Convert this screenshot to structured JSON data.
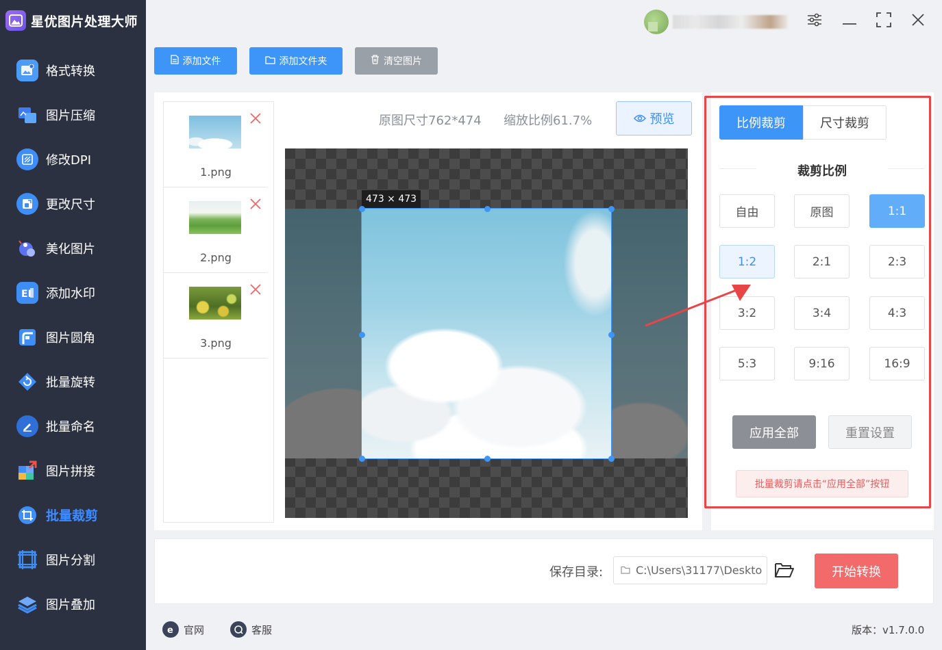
{
  "app": {
    "title": "星优图片处理大师",
    "logo_icon": "mountain-photo-icon"
  },
  "sidebar": {
    "items": [
      {
        "label": "格式转换",
        "icon": "image-convert-icon",
        "color": "#4b9bf7"
      },
      {
        "label": "图片压缩",
        "icon": "image-compress-icon",
        "color": "#3e7cf0"
      },
      {
        "label": "修改DPI",
        "icon": "dpi-icon",
        "color": "#3e8ef5"
      },
      {
        "label": "更改尺寸",
        "icon": "resize-icon",
        "color": "#3e8ef5"
      },
      {
        "label": "美化图片",
        "icon": "beautify-icon",
        "color": "#5a72f0"
      },
      {
        "label": "添加水印",
        "icon": "watermark-icon",
        "color": "#3e8ef5"
      },
      {
        "label": "图片圆角",
        "icon": "rounded-corner-icon",
        "color": "#3e8ef5"
      },
      {
        "label": "批量旋转",
        "icon": "rotate-icon",
        "color": "#3e8ef5"
      },
      {
        "label": "批量命名",
        "icon": "rename-icon",
        "color": "#3e8ef5"
      },
      {
        "label": "图片拼接",
        "icon": "puzzle-icon",
        "color": "#e8534a"
      },
      {
        "label": "批量裁剪",
        "icon": "crop-icon",
        "color": "#3e8ef5",
        "active": true
      },
      {
        "label": "图片分割",
        "icon": "split-icon",
        "color": "#3e8ef5"
      },
      {
        "label": "图片叠加",
        "icon": "layers-icon",
        "color": "#3e8ef5"
      }
    ]
  },
  "toolbar": {
    "add_file": "添加文件",
    "add_folder": "添加文件夹",
    "clear": "清空图片"
  },
  "files": [
    {
      "name": "1.png",
      "thumb": "sky-clouds"
    },
    {
      "name": "2.png",
      "thumb": "green-field"
    },
    {
      "name": "3.png",
      "thumb": "yellow-flowers"
    }
  ],
  "preview": {
    "original_size": "原图尺寸762*474",
    "zoom_ratio": "缩放比例61.7%",
    "preview_label": "预览",
    "crop_dimensions": "473 × 473"
  },
  "crop_panel": {
    "tab_ratio": "比例裁剪",
    "tab_size": "尺寸裁剪",
    "section_title": "裁剪比例",
    "ratios": [
      "自由",
      "原图",
      "1:1",
      "1:2",
      "2:1",
      "2:3",
      "3:2",
      "3:4",
      "4:3",
      "5:3",
      "9:16",
      "16:9"
    ],
    "selected_ratio": "1:1",
    "hovered_ratio": "1:2",
    "apply_all": "应用全部",
    "reset": "重置设置",
    "hint": "批量裁剪请点击“应用全部”按钮",
    "highlight_color": "#e84646"
  },
  "output": {
    "save_label": "保存目录:",
    "save_path": "C:\\Users\\31177\\Deskto",
    "start_button": "开始转换"
  },
  "footer": {
    "website": "官网",
    "support": "客服",
    "version": "版本：v1.7.0.0"
  },
  "colors": {
    "accent": "#3e95f8",
    "sidebar_bg": "#2c3142",
    "danger": "#f26a6a"
  }
}
